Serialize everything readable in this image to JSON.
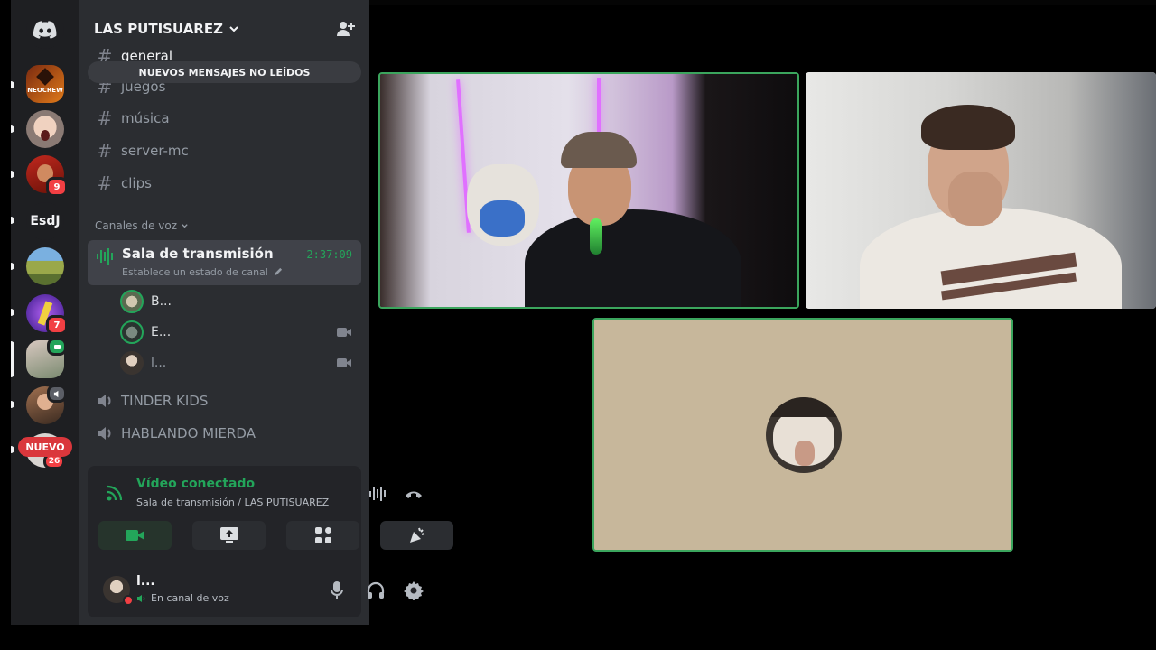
{
  "servers": [
    {
      "name": "NEOCREW",
      "icon": "neocrew-server-icon",
      "badge": null
    },
    {
      "name": "",
      "icon": "screaming-face-server-icon",
      "badge": null
    },
    {
      "name": "",
      "icon": "red-avatar-server-icon",
      "badge": "9"
    },
    {
      "name": "EsdJ",
      "icon": "text-server-icon",
      "badge": null
    },
    {
      "name": "",
      "icon": "landscape-server-icon",
      "badge": null
    },
    {
      "name": "",
      "icon": "purple-server-icon",
      "badge": "7"
    },
    {
      "name": "",
      "icon": "selected-server-icon",
      "badge": null
    },
    {
      "name": "",
      "icon": "speaker-server-icon",
      "badge": null
    },
    {
      "name": "",
      "icon": "new-server-icon",
      "badge": "26"
    }
  ],
  "rail": {
    "new_label": "NUEVO"
  },
  "server": {
    "name": "LAS PUTISUAREZ",
    "new_messages": "NUEVOS MENSAJES NO LEÍDOS"
  },
  "channels": {
    "text": [
      "general",
      "juegos",
      "música",
      "server-mc",
      "clips"
    ],
    "voice_category": "Canales de voz",
    "active_voice": {
      "name": "Sala de transmisión",
      "time": "2:37:09",
      "status": "Establece un estado de canal"
    },
    "voice_users": [
      {
        "name": "B..."
      },
      {
        "name": "E..."
      },
      {
        "name": "l..."
      }
    ],
    "voice_other": [
      "TINDER KIDS",
      "HABLANDO MIERDA"
    ]
  },
  "voice_panel": {
    "title": "Vídeo conectado",
    "subtitle": "Sala de transmisión / LAS PUTISUAREZ"
  },
  "user": {
    "name": "l...",
    "status": "En canal de voz"
  },
  "colors": {
    "accent_green": "#23a55a",
    "badge_red": "#f23f43",
    "sidebar_bg": "#2b2d31",
    "rail_bg": "#1e1f22"
  }
}
